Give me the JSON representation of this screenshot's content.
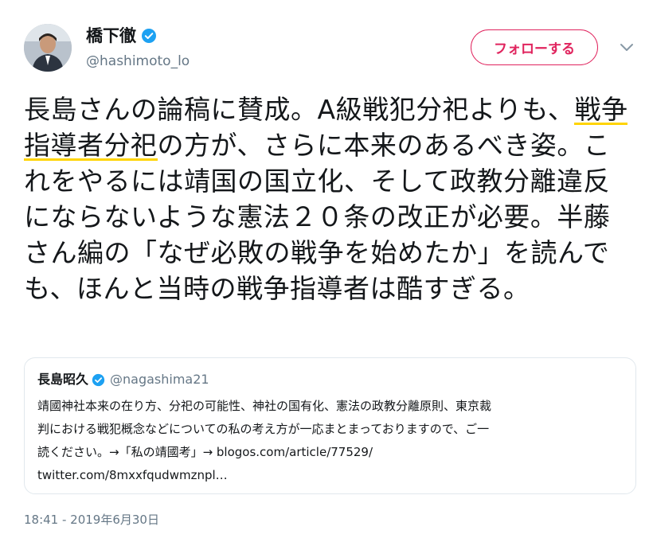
{
  "user": {
    "display_name": "橋下徹",
    "handle": "@hashimoto_lo",
    "verified_icon": "verified-badge",
    "avatar_icon": "profile-photo"
  },
  "header": {
    "follow_label": "フォローする",
    "menu_icon": "chevron-down-icon"
  },
  "tweet": {
    "text_before": "長島さんの論稿に賛成。A級戦犯分祀よりも、",
    "highlight": "戦争指導者分祀",
    "text_after": "の方が、さらに本来のあるべき姿。これをやるには靖国の国立化、そして政教分離違反にならないような憲法２０条の改正が必要。半藤さん編の「なぜ必敗の戦争を始めたか」を読んでも、ほんと当時の戦争指導者は酷すぎる。"
  },
  "quote": {
    "display_name": "長島昭久",
    "handle": "@nagashima21",
    "lines": [
      "靖國神社本来の在り方、分祀の可能性、神社の国有化、憲法の政教分離原則、東京裁",
      "判における戦犯概念などについての私の考え方が一応まとまっておりますので、ご一",
      "読ください。→「私の靖國考」→ blogos.com/article/77529/",
      "twitter.com/8mxxfqudwmznpl…"
    ]
  },
  "timestamp": "18:41 - 2019年6月30日",
  "colors": {
    "accent_follow": "#e0245e",
    "verified_blue": "#1da1f2",
    "secondary_text": "#657786",
    "highlight_underline": "#ffd400",
    "border": "#e1e8ed"
  }
}
